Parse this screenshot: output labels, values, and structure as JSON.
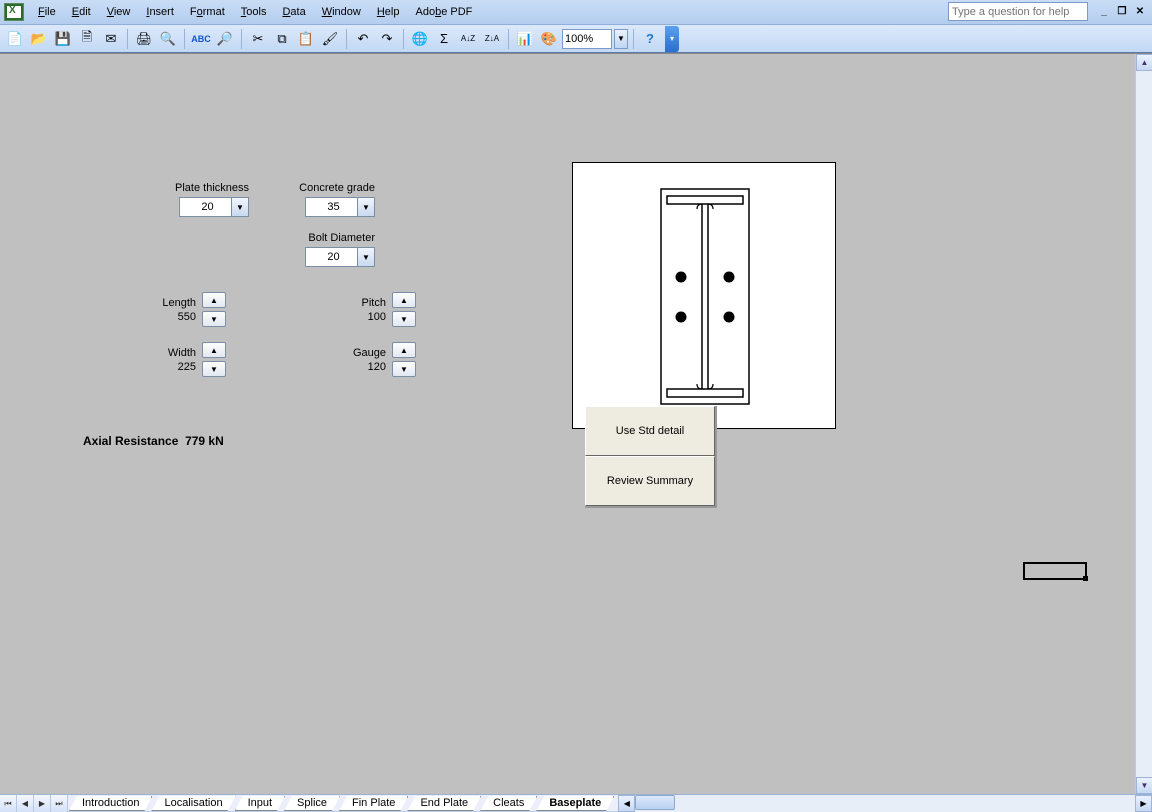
{
  "menubar": {
    "items": [
      "File",
      "Edit",
      "View",
      "Insert",
      "Format",
      "Tools",
      "Data",
      "Window",
      "Help",
      "Adobe PDF"
    ],
    "help_placeholder": "Type a question for help"
  },
  "toolbar": {
    "zoom": "100%"
  },
  "params": {
    "plate_thickness_label": "Plate thickness",
    "plate_thickness_value": "20",
    "concrete_grade_label": "Concrete grade",
    "concrete_grade_value": "35",
    "bolt_diameter_label": "Bolt Diameter",
    "bolt_diameter_value": "20",
    "length_label": "Length",
    "length_value": "550",
    "width_label": "Width",
    "width_value": "225",
    "pitch_label": "Pitch",
    "pitch_value": "100",
    "gauge_label": "Gauge",
    "gauge_value": "120"
  },
  "axial": {
    "label": "Axial Resistance",
    "value": "779 kN"
  },
  "buttons": {
    "use_std": "Use Std detail",
    "review": "Review Summary"
  },
  "tabs": [
    "Introduction",
    "Localisation",
    "Input",
    "Splice",
    "Fin Plate",
    "End Plate",
    "Cleats",
    "Baseplate"
  ],
  "active_tab": "Baseplate"
}
